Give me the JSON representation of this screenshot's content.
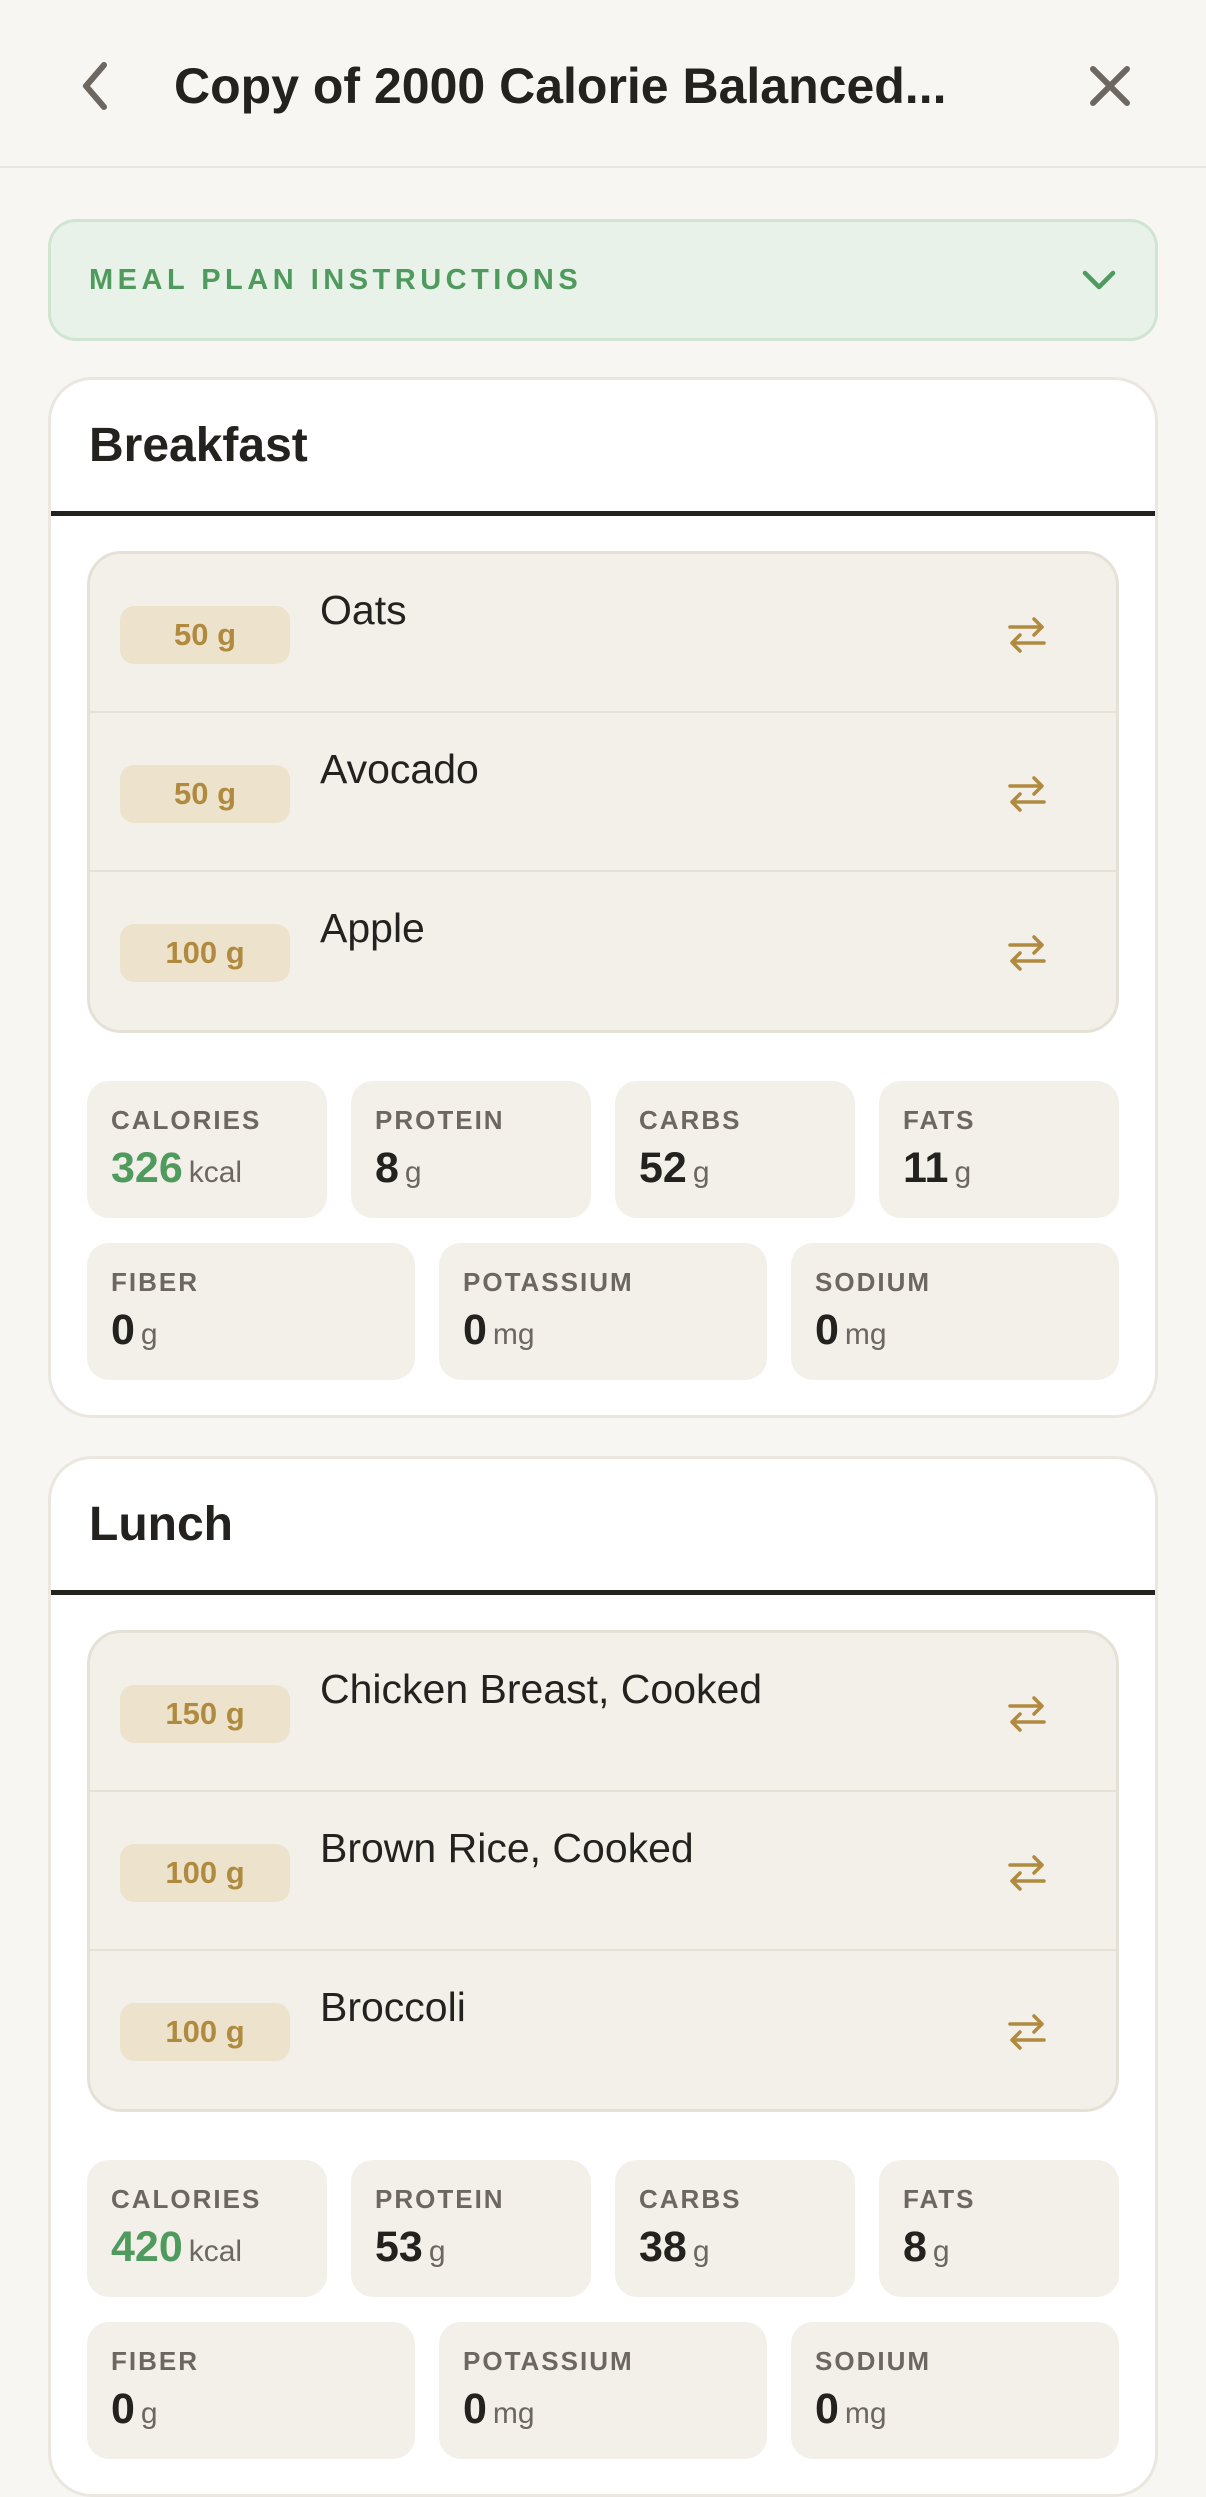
{
  "header": {
    "title": "Copy of 2000 Calorie Balanced...",
    "back_icon": "chevron-left-icon",
    "close_icon": "close-icon"
  },
  "instructions": {
    "label": "MEAL PLAN INSTRUCTIONS",
    "icon": "chevron-down-icon"
  },
  "colors": {
    "accent_green": "#4f9a5d",
    "accent_gold": "#b08a3e",
    "background": "#f7f6f2"
  },
  "meals": [
    {
      "title": "Breakfast",
      "foods": [
        {
          "qty": "50 g",
          "name": "Oats"
        },
        {
          "qty": "50 g",
          "name": "Avocado"
        },
        {
          "qty": "100 g",
          "name": "Apple"
        }
      ],
      "stats": [
        {
          "label": "CALORIES",
          "value": "326",
          "unit": "kcal"
        },
        {
          "label": "PROTEIN",
          "value": "8",
          "unit": "g"
        },
        {
          "label": "CARBS",
          "value": "52",
          "unit": "g"
        },
        {
          "label": "FATS",
          "value": "11",
          "unit": "g"
        },
        {
          "label": "FIBER",
          "value": "0",
          "unit": "g"
        },
        {
          "label": "POTASSIUM",
          "value": "0",
          "unit": "mg"
        },
        {
          "label": "SODIUM",
          "value": "0",
          "unit": "mg"
        }
      ]
    },
    {
      "title": "Lunch",
      "foods": [
        {
          "qty": "150 g",
          "name": "Chicken Breast, Cooked"
        },
        {
          "qty": "100 g",
          "name": "Brown Rice, Cooked"
        },
        {
          "qty": "100 g",
          "name": "Broccoli"
        }
      ],
      "stats": [
        {
          "label": "CALORIES",
          "value": "420",
          "unit": "kcal"
        },
        {
          "label": "PROTEIN",
          "value": "53",
          "unit": "g"
        },
        {
          "label": "CARBS",
          "value": "38",
          "unit": "g"
        },
        {
          "label": "FATS",
          "value": "8",
          "unit": "g"
        },
        {
          "label": "FIBER",
          "value": "0",
          "unit": "g"
        },
        {
          "label": "POTASSIUM",
          "value": "0",
          "unit": "mg"
        },
        {
          "label": "SODIUM",
          "value": "0",
          "unit": "mg"
        }
      ]
    }
  ]
}
